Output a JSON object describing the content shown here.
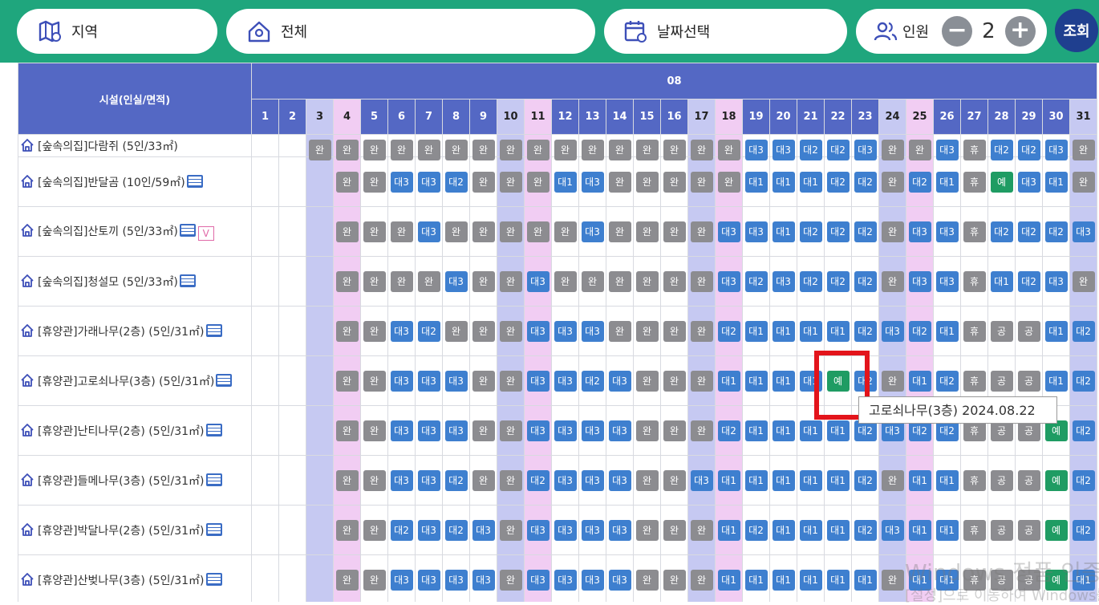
{
  "filters": {
    "region_label": "지역",
    "area_label": "전체",
    "date_label": "날짜선택",
    "people_label": "인원",
    "people_count": "2",
    "minus_label": "−",
    "plus_label": "+",
    "search_label": "조회"
  },
  "table": {
    "facility_header": "시설(인실/면적)",
    "month": "08",
    "days": [
      "1",
      "2",
      "3",
      "4",
      "5",
      "6",
      "7",
      "8",
      "9",
      "10",
      "11",
      "12",
      "13",
      "14",
      "15",
      "16",
      "17",
      "18",
      "19",
      "20",
      "21",
      "22",
      "23",
      "24",
      "25",
      "26",
      "27",
      "28",
      "29",
      "30",
      "31"
    ],
    "partial_row": {
      "name": "[숲속의집]다람쥐 (5인/33㎡)",
      "statuses": [
        "",
        "",
        "완",
        "완",
        "완",
        "완",
        "완",
        "완",
        "완",
        "완",
        "완",
        "완",
        "완",
        "완",
        "완",
        "완",
        "완",
        "완",
        "대3",
        "대3",
        "대2",
        "대2",
        "대3",
        "완",
        "완",
        "대3",
        "휴",
        "대2",
        "대2",
        "대3",
        "완"
      ]
    },
    "rows": [
      {
        "name": "[숲속의집]반달곰 (10인/59㎡)",
        "ac": true,
        "v": false,
        "statuses": [
          "",
          "",
          "",
          "완",
          "완",
          "대3",
          "대3",
          "대2",
          "완",
          "완",
          "완",
          "대1",
          "대3",
          "완",
          "완",
          "완",
          "완",
          "완",
          "대1",
          "대1",
          "대1",
          "대2",
          "대2",
          "완",
          "대2",
          "대1",
          "휴",
          "예",
          "대3",
          "대1",
          "완"
        ]
      },
      {
        "name": "[숲속의집]산토끼 (5인/33㎡)",
        "ac": true,
        "v": true,
        "v_label": "V",
        "statuses": [
          "",
          "",
          "",
          "완",
          "완",
          "완",
          "대3",
          "완",
          "완",
          "완",
          "완",
          "완",
          "대3",
          "완",
          "완",
          "완",
          "완",
          "대3",
          "대3",
          "대1",
          "대2",
          "대2",
          "대2",
          "완",
          "대3",
          "대3",
          "휴",
          "대2",
          "대2",
          "대2",
          "대3"
        ]
      },
      {
        "name": "[숲속의집]청설모 (5인/33㎡)",
        "ac": true,
        "v": false,
        "statuses": [
          "",
          "",
          "",
          "완",
          "완",
          "완",
          "완",
          "대3",
          "완",
          "완",
          "대3",
          "완",
          "완",
          "완",
          "완",
          "완",
          "완",
          "대3",
          "대2",
          "대3",
          "대2",
          "대2",
          "대2",
          "완",
          "대3",
          "대3",
          "휴",
          "대1",
          "대2",
          "대3",
          "완"
        ]
      },
      {
        "name": "[휴양관]가래나무(2층) (5인/31㎡)",
        "ac": true,
        "v": false,
        "statuses": [
          "",
          "",
          "",
          "완",
          "완",
          "대3",
          "대2",
          "완",
          "완",
          "완",
          "대3",
          "대3",
          "대3",
          "완",
          "완",
          "완",
          "완",
          "대2",
          "대1",
          "대1",
          "대1",
          "대1",
          "대2",
          "대3",
          "대2",
          "대1",
          "휴",
          "공",
          "공",
          "대1",
          "대2"
        ]
      },
      {
        "name": "[휴양관]고로쇠나무(3층) (5인/31㎡)",
        "ac": true,
        "v": false,
        "statuses": [
          "",
          "",
          "",
          "완",
          "완",
          "대3",
          "대3",
          "대3",
          "완",
          "완",
          "대3",
          "대3",
          "대2",
          "대3",
          "완",
          "완",
          "완",
          "대1",
          "대1",
          "대1",
          "대1",
          "예",
          "대2",
          "완",
          "대1",
          "대2",
          "휴",
          "공",
          "공",
          "대1",
          "대2"
        ]
      },
      {
        "name": "[휴양관]난티나무(2층) (5인/31㎡)",
        "ac": true,
        "v": false,
        "statuses": [
          "",
          "",
          "",
          "완",
          "완",
          "대3",
          "대3",
          "대3",
          "완",
          "완",
          "대3",
          "대3",
          "대3",
          "대3",
          "완",
          "완",
          "완",
          "대2",
          "대1",
          "대1",
          "대1",
          "대1",
          "대2",
          "대3",
          "대2",
          "대2",
          "휴",
          "공",
          "공",
          "예",
          "대2"
        ]
      },
      {
        "name": "[휴양관]들메나무(3층) (5인/31㎡)",
        "ac": true,
        "v": false,
        "statuses": [
          "",
          "",
          "",
          "완",
          "완",
          "대3",
          "대3",
          "대2",
          "완",
          "완",
          "대2",
          "대3",
          "대3",
          "대3",
          "완",
          "완",
          "대3",
          "대1",
          "대1",
          "대1",
          "대1",
          "대1",
          "대2",
          "완",
          "대1",
          "대1",
          "휴",
          "공",
          "공",
          "예",
          "대2"
        ]
      },
      {
        "name": "[휴양관]박달나무(2층) (5인/31㎡)",
        "ac": true,
        "v": false,
        "statuses": [
          "",
          "",
          "",
          "완",
          "완",
          "대2",
          "대3",
          "대2",
          "대3",
          "완",
          "대3",
          "대3",
          "대3",
          "대3",
          "완",
          "완",
          "완",
          "대1",
          "대2",
          "대1",
          "대1",
          "대1",
          "대2",
          "대3",
          "대1",
          "대1",
          "휴",
          "공",
          "공",
          "예",
          "대2"
        ]
      },
      {
        "name": "[휴양관]산벚나무(3층) (5인/31㎡)",
        "ac": true,
        "v": false,
        "statuses": [
          "",
          "",
          "",
          "완",
          "완",
          "대3",
          "대3",
          "대3",
          "대3",
          "완",
          "대3",
          "대3",
          "대3",
          "대3",
          "완",
          "완",
          "완",
          "대1",
          "대1",
          "대1",
          "대1",
          "대1",
          "대1",
          "완",
          "대1",
          "대1",
          "휴",
          "공",
          "공",
          "예",
          "대1"
        ]
      }
    ]
  },
  "tooltip": {
    "text": "고로쇠나무(3층) 2024.08.22"
  },
  "watermark": {
    "line1": "Windows 정품 인증",
    "line2": "[설정]으로 이동하여 Windows를"
  },
  "colors": {
    "header": "#5468c4",
    "topbar": "#1fa67d",
    "saturday": "#c6c9f2",
    "sunday": "#f1cdf3",
    "status_done": "#8c8c90",
    "status_wait": "#3e7fcf",
    "status_reserve": "#1f9c63",
    "highlight": "#e3141b"
  },
  "icons": {
    "region": "map-pin-icon",
    "area": "location-icon",
    "date": "calendar-icon",
    "people": "people-icon",
    "facility": "home-icon",
    "aircon": "air-conditioner-icon"
  }
}
